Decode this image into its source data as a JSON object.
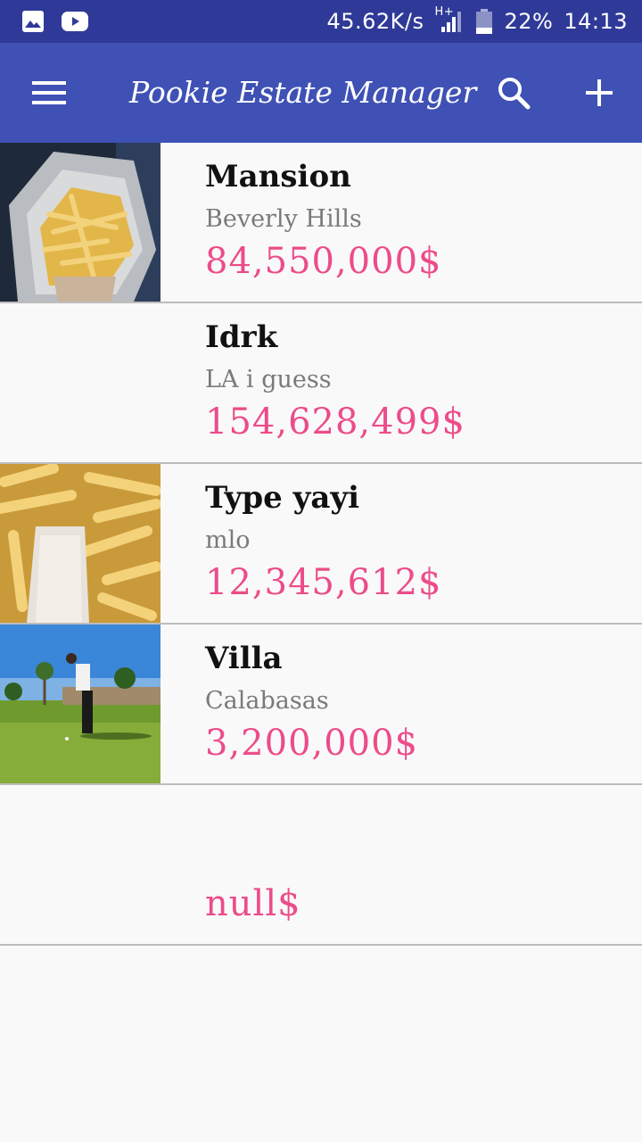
{
  "status_bar": {
    "net_speed": "45.62K/s",
    "network_type": "H+",
    "battery": "22%",
    "time": "14:13",
    "icons": [
      "image-icon",
      "youtube-icon",
      "signal-icon",
      "battery-icon"
    ]
  },
  "app_bar": {
    "title": "Pookie Estate Manager",
    "icons": [
      "menu-icon",
      "search-icon",
      "add-icon"
    ]
  },
  "colors": {
    "status_bar": "#2f3a98",
    "app_bar": "#3f51b5",
    "price": "#ec4c89",
    "background": "#f9f9f9"
  },
  "listings": [
    {
      "name": "Mansion",
      "location": "Beverly Hills",
      "price": "84,550,000$",
      "thumbnail": "fries-wrap-photo"
    },
    {
      "name": "Idrk",
      "location": "LA i guess",
      "price": "154,628,499$",
      "thumbnail": ""
    },
    {
      "name": "Type yayi",
      "location": "mlo",
      "price": "12,345,612$",
      "thumbnail": "fries-closeup-photo"
    },
    {
      "name": "Villa",
      "location": "Calabasas",
      "price": "3,200,000$",
      "thumbnail": "golf-course-photo"
    },
    {
      "name": "",
      "location": "",
      "price": "null$",
      "thumbnail": ""
    }
  ]
}
